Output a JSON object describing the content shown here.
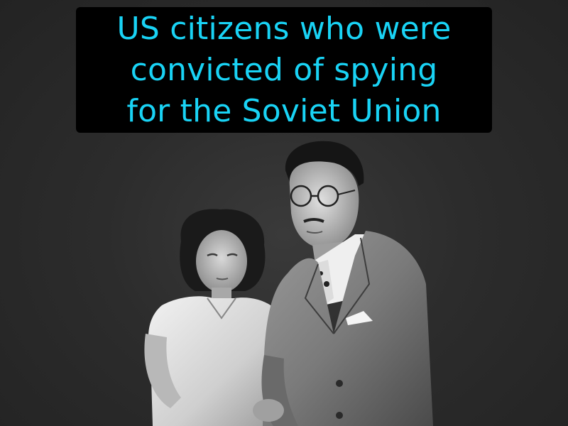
{
  "caption": {
    "text": "US citizens who were\nconvicted of spying\nfor the Soviet Union",
    "color": "#19d3f5",
    "background": "#000000"
  },
  "photo": {
    "style": "black-and-white photograph"
  }
}
